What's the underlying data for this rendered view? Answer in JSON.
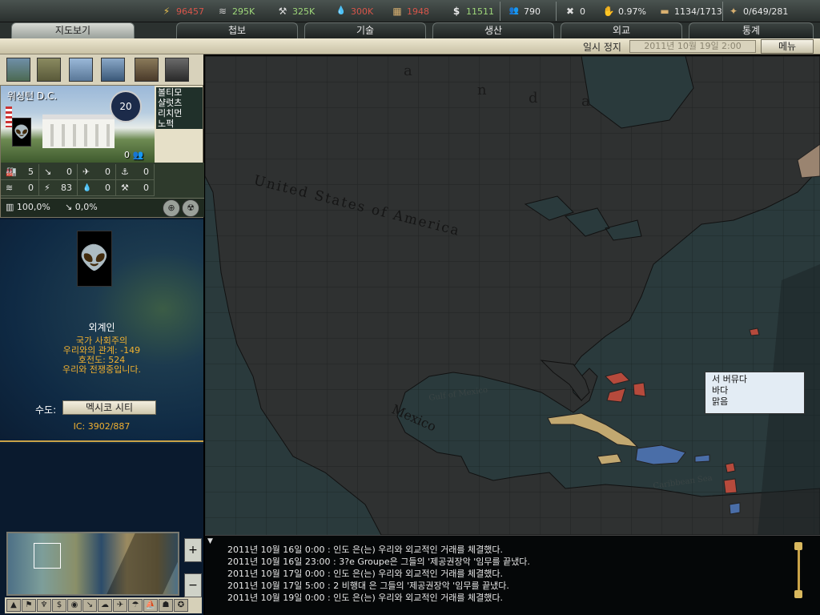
{
  "resources": [
    {
      "icon": "energy-icon",
      "glyph": "⚡",
      "value": "96457",
      "color": "red"
    },
    {
      "icon": "metal-icon",
      "glyph": "≋",
      "value": "295K",
      "color": "grn"
    },
    {
      "icon": "rare-materials-icon",
      "glyph": "⚒",
      "value": "325K",
      "color": "grn"
    },
    {
      "icon": "oil-icon",
      "glyph": "💧",
      "value": "300K",
      "color": "red"
    },
    {
      "icon": "supplies-icon",
      "glyph": "▦",
      "value": "1948",
      "color": "red"
    },
    {
      "icon": "money-icon",
      "glyph": "$",
      "value": "11511",
      "color": "grn"
    },
    {
      "icon": "manpower-icon",
      "glyph": "👥",
      "value": "790",
      "color": "wht"
    },
    {
      "icon": "nuke-icon",
      "glyph": "✖",
      "value": "0",
      "color": "wht"
    },
    {
      "icon": "dissent-icon",
      "glyph": "✋",
      "value": "0.97%",
      "color": "wht"
    },
    {
      "icon": "transport-icon",
      "glyph": "▬",
      "value": "1134/1713",
      "color": "wht"
    },
    {
      "icon": "convoy-icon",
      "glyph": "✦",
      "value": "0/649/281",
      "color": "wht"
    }
  ],
  "tabs": [
    "지도보기",
    "첩보",
    "기술",
    "생산",
    "외교",
    "통계"
  ],
  "status": {
    "pause": "일시 정지",
    "date": "2011년 10월 19일 2:00",
    "menu": "메뉴"
  },
  "province": {
    "name": "워싱턴 D.C.",
    "star_value": "20",
    "infantry_count": "0",
    "neighbors": [
      "볼티모",
      "샬럿츠",
      "리치먼",
      "노퍽"
    ],
    "buildings_row1": [
      {
        "icon": "factory-icon",
        "glyph": "🏭",
        "value": "5"
      },
      {
        "icon": "anti-air-icon",
        "glyph": "↘",
        "value": "0"
      },
      {
        "icon": "airbase-icon",
        "glyph": "✈",
        "value": "0"
      },
      {
        "icon": "naval-base-icon",
        "glyph": "⚓",
        "value": "0"
      }
    ],
    "buildings_row2": [
      {
        "icon": "metal-icon",
        "glyph": "≋",
        "value": "0"
      },
      {
        "icon": "energy-icon",
        "glyph": "⚡",
        "value": "83"
      },
      {
        "icon": "oil-icon",
        "glyph": "💧",
        "value": "0"
      },
      {
        "icon": "rare-materials-icon",
        "glyph": "⚒",
        "value": "0"
      }
    ],
    "infrastructure": "100,0%",
    "radar": "0,0%"
  },
  "country": {
    "name": "외계인",
    "lines": [
      "국가 사회주의",
      "우리와의 관계: -149",
      "호전도: 524",
      "우리와 전쟁중입니다."
    ],
    "capital_label": "수도:",
    "capital": "멕시코 시티",
    "ic": "IC: 3902/887"
  },
  "map_labels": {
    "canada_a": "a",
    "canada_n": "n",
    "canada_d": "d",
    "canada_a2": "a",
    "usa": "United States of America",
    "mexico": "Mexico",
    "gulf": "Gulf of Mexico",
    "caribbean": "Caribbean Sea"
  },
  "tooltip": [
    "서 버뮤다",
    "바다",
    "맑음"
  ],
  "log": [
    "2011년 10월 16일 0:00  : 인도 은(는) 우리와 외교적인 거래를 체결했다.",
    "2011년 10월 16일 23:00  : 3?e Groupe은 그들의 '제공권장악 '임무를 끝냈다.",
    "2011년 10월 17일 0:00  : 인도 은(는) 우리와 외교적인 거래를 체결했다.",
    "2011년 10월 17일 5:00  : 2 비행대 은 그들의 '제공권장악 '임무를 끝냈다.",
    "2011년 10월 19일 0:00  : 인도 은(는) 우리와 외교적인 거래를 체결했다."
  ],
  "colors": {
    "accent_gold": "#c9a248",
    "enemy_red": "#b64a3c",
    "ally_blue": "#4a6ea8",
    "neutral_tan": "#c2a870"
  }
}
